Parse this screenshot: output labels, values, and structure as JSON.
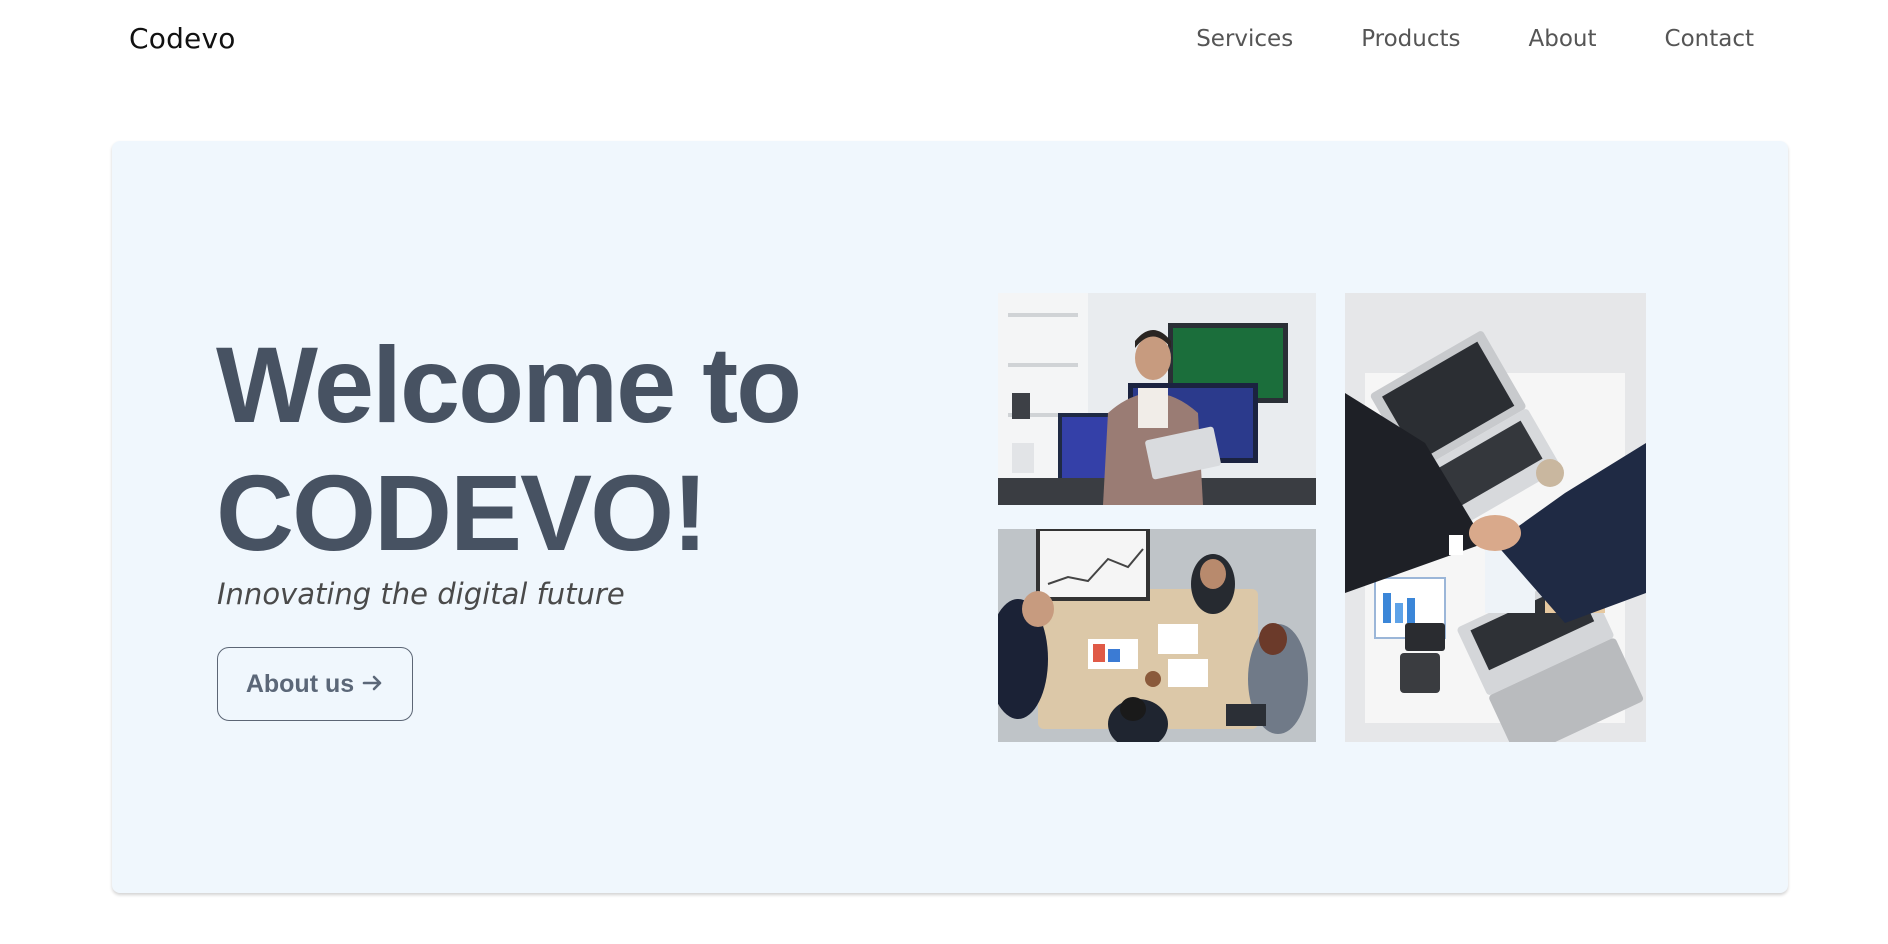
{
  "header": {
    "brand": "Codevo",
    "nav": [
      {
        "label": "Services"
      },
      {
        "label": "Products"
      },
      {
        "label": "About"
      },
      {
        "label": "Contact"
      }
    ]
  },
  "hero": {
    "title_line1": "Welcome to",
    "title_line2": "CODEVO!",
    "tagline": "Innovating the digital future",
    "button_label": "About us",
    "button_icon": "arrow-right-icon",
    "background": "#f0f7fd",
    "title_color": "#475262"
  },
  "gallery": {
    "images": [
      {
        "name": "developer-photo"
      },
      {
        "name": "team-meeting-photo"
      },
      {
        "name": "handshake-photo"
      }
    ]
  }
}
